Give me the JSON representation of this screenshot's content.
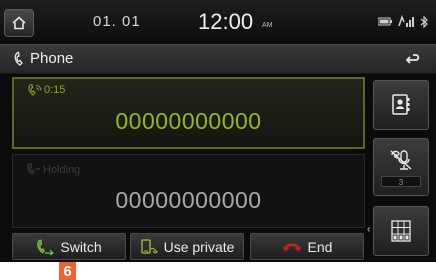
{
  "status_bar": {
    "date": "01. 01",
    "time": "12:00",
    "ampm": "AM"
  },
  "header": {
    "title": "Phone"
  },
  "active_call": {
    "timer": "0:15",
    "number": "00000000000"
  },
  "held_call": {
    "label": "Holding",
    "number": "00000000000"
  },
  "side_panel": {
    "mic_level": "3"
  },
  "buttons": {
    "switch": "Switch",
    "use_private": "Use private",
    "end": "End"
  },
  "callout": "6",
  "colors": {
    "active_number": "#94b91f",
    "active_border": "#5b6a1e",
    "end_icon": "#c0281a",
    "callout_bg": "#f0622f"
  },
  "icons": [
    "home-icon",
    "battery-icon",
    "signal-icon",
    "bluetooth-icon",
    "phone-icon",
    "back-arrow-icon",
    "contacts-icon",
    "mic-mute-icon",
    "keypad-icon",
    "switch-call-icon",
    "use-private-icon",
    "end-call-icon"
  ]
}
